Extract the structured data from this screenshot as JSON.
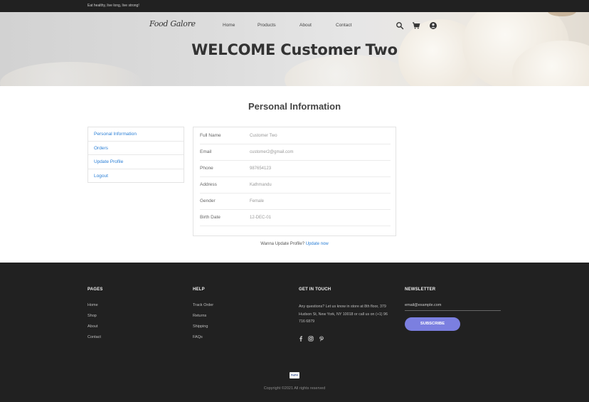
{
  "topbar": {
    "tagline": "Eat healthy, live long, live strong!"
  },
  "header": {
    "logo": "Food Galore",
    "nav": [
      "Home",
      "Products",
      "About",
      "Contact"
    ],
    "icons": [
      "search-icon",
      "cart-icon",
      "user-icon"
    ],
    "welcome": "WELCOME Customer Two"
  },
  "main": {
    "title": "Personal Information",
    "menu": [
      "Personal Information",
      "Orders",
      "Update Profile",
      "Logout"
    ],
    "info": [
      {
        "label": "Full Name",
        "value": "Customer Two"
      },
      {
        "label": "Email",
        "value": "customer2@gmail.com"
      },
      {
        "label": "Phone",
        "value": "987654123"
      },
      {
        "label": "Address",
        "value": "Kathmandu"
      },
      {
        "label": "Gender",
        "value": "Female"
      },
      {
        "label": "Birth Date",
        "value": "12-DEC-01"
      }
    ],
    "update_prompt": "Wanna Update Profile?",
    "update_link": "Update now"
  },
  "footer": {
    "pages_title": "PAGES",
    "pages": [
      "Home",
      "Shop",
      "About",
      "Contact"
    ],
    "help_title": "HELP",
    "help": [
      "Track Order",
      "Returns",
      "Shipping",
      "FAQs"
    ],
    "touch_title": "GET IN TOUCH",
    "touch_text": "Any questions? Let us know in store at 8th floor, 379 Hudson St, New York, NY 10018 or call us on (+1) 96 716 6879",
    "social": [
      "facebook-icon",
      "instagram-icon",
      "pinterest-icon"
    ],
    "newsletter_title": "NEWSLETTER",
    "email_placeholder": "email@example.com",
    "subscribe": "SUBSCRIBE",
    "payment": "PayPal",
    "copyright": "Copyright ©2021 All rights reserved"
  },
  "colors": {
    "accent": "#7b7fe0",
    "link": "#2b7fd6",
    "dark": "#212121"
  }
}
